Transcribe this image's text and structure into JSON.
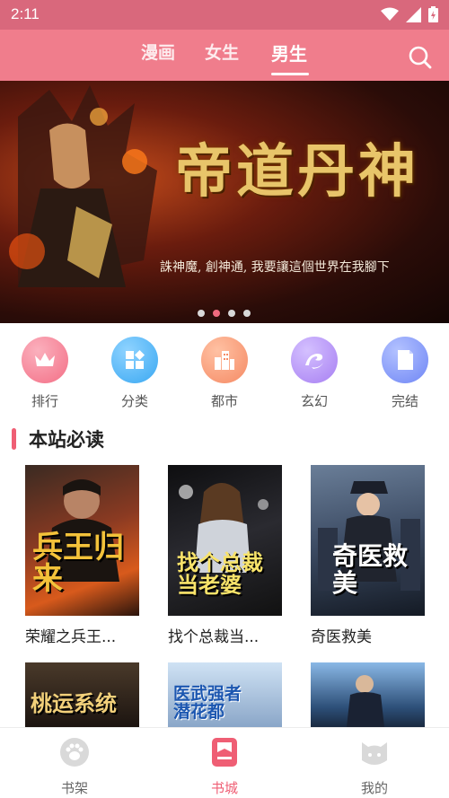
{
  "status": {
    "time": "2:11"
  },
  "nav": {
    "tabs": [
      "漫画",
      "女生",
      "男生"
    ],
    "active_index": 2
  },
  "banner": {
    "title": "帝道丹神",
    "caption": "誅神魔, 創神通, 我要讓這個世界在我腳下",
    "dot_count": 4,
    "active_dot": 1
  },
  "categories": [
    {
      "label": "排行",
      "icon": "crown-icon",
      "color": "#f36f86"
    },
    {
      "label": "分类",
      "icon": "grid-icon",
      "color": "#3aa8f2"
    },
    {
      "label": "都市",
      "icon": "city-icon",
      "color": "#f58a64"
    },
    {
      "label": "玄幻",
      "icon": "swirl-icon",
      "color": "#a77ff2"
    },
    {
      "label": "完结",
      "icon": "book-icon",
      "color": "#6f86f5"
    }
  ],
  "section": {
    "title": "本站必读"
  },
  "books": [
    {
      "title": "荣耀之兵王...",
      "cover_text": "兵王归来"
    },
    {
      "title": "找个总裁当...",
      "cover_text": "找个总裁当老婆"
    },
    {
      "title": "奇医救美",
      "cover_text": "奇医救美"
    },
    {
      "title": "",
      "cover_text": "桃运系统"
    },
    {
      "title": "",
      "cover_text": "医武强者潜花都"
    },
    {
      "title": "",
      "cover_text": ""
    }
  ],
  "tabbar": {
    "items": [
      "书架",
      "书城",
      "我的"
    ],
    "active_index": 1,
    "accent": "#ef5e74"
  }
}
